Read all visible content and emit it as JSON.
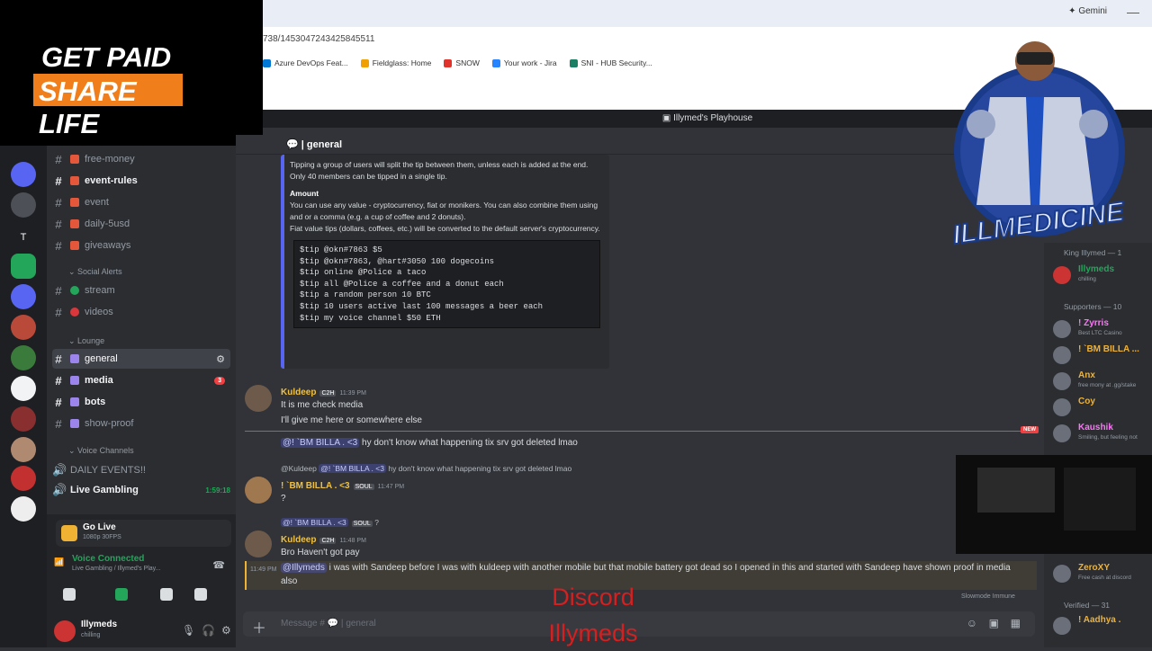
{
  "promo": {
    "line1": "GET PAID",
    "line2": "SHARE LIFE"
  },
  "browser": {
    "gemini_label": "Gemini",
    "url": "738/1453047243425845511",
    "bookmarks": [
      {
        "label": "Azure DevOps Feat...",
        "color": "#0078d4"
      },
      {
        "label": "Fieldglass: Home",
        "color": "#f0a000"
      },
      {
        "label": "SNOW",
        "color": "#e0332b"
      },
      {
        "label": "Your work - Jira",
        "color": "#2684ff"
      },
      {
        "label": "SNI - HUB Security...",
        "color": "#1a7f64"
      }
    ]
  },
  "server": {
    "title": "Illymed's Playhouse"
  },
  "channel_header": {
    "name": "general"
  },
  "sidebar": {
    "channels_top": [
      {
        "label": "free-money",
        "bold": false
      },
      {
        "label": "event-rules",
        "bold": true
      },
      {
        "label": "event",
        "bold": false
      },
      {
        "label": "daily-5usd",
        "bold": false
      },
      {
        "label": "giveaways",
        "bold": false
      }
    ],
    "social_category": "Social Alerts",
    "social_channels": [
      {
        "label": "stream",
        "color": "#23a55a"
      },
      {
        "label": "videos",
        "color": "#da373c"
      }
    ],
    "lounge_category": "Lounge",
    "lounge_channels": [
      {
        "label": "general",
        "active": true
      },
      {
        "label": "media",
        "badge": "3",
        "bold": true
      },
      {
        "label": "bots",
        "bold": true
      },
      {
        "label": "show-proof",
        "bold": false
      }
    ],
    "voice_category": "Voice Channels",
    "voice_channels": [
      {
        "label": "DAILY EVENTS!!"
      },
      {
        "label": "Live Gambling",
        "timer": "1:59:18"
      }
    ]
  },
  "voice_panel": {
    "golive_label": "Go Live",
    "golive_sub": "1080p 30FPS",
    "status": "Voice Connected",
    "location": "Live Gambling / Illymed's Play..."
  },
  "user": {
    "name": "Illymeds",
    "status": "chilling"
  },
  "embed": {
    "para1": "Tipping a group of users will split the tip between them, unless each is added at the end.",
    "para2": "Only 40 members can be tipped in a single tip.",
    "heading": "Amount",
    "para3": "You can use any value - cryptocurrency, fiat or monikers. You can also combine them using and or a comma (e.g. a cup of coffee and 2 donuts).",
    "para4": "Fiat value tips (dollars, coffees, etc.) will be converted to the default server's cryptocurrency.",
    "code": "$tip @okn#7863 $5\n$tip @okn#7863, @hart#3050 100 dogecoins\n$tip online @Police a taco\n$tip all @Police a coffee and a donut each\n$tip a random person 10 BTC\n$tip 10 users active last 100 messages a beer each\n$tip my voice channel $50 ETH"
  },
  "messages": {
    "m1": {
      "author": "Kuldeep",
      "tag": "C2H",
      "time": "11:39 PM",
      "line1": "It is me check media",
      "line2": "I'll give me here or somewhere else"
    },
    "m1_mention": "@! `BM BILLA . <3",
    "m1_mention_text": "hy don't know what happening tix srv got deleted lmao",
    "new_label": "NEW",
    "m2": {
      "reply_author": "@Kuldeep",
      "reply_mention": "@! `BM BILLA . <3",
      "reply_text": "hy don't know what happening tix srv got deleted lmao",
      "author": "! `BM BILLA . <3",
      "tag": "SOUL",
      "time": "11:47 PM",
      "line1": "?"
    },
    "m3": {
      "reply_author": "@! `BM BILLA . <3",
      "reply_tag": "SOUL",
      "reply_text": "?",
      "author": "Kuldeep",
      "tag": "C2H",
      "time": "11:48 PM",
      "line1": "Bro Haven't got pay"
    },
    "m4": {
      "time": "11:49 PM",
      "mention": "@Illymeds",
      "text": "i was with Sandeep before I was with kuldeep with another mobile but that mobile battery got dead so I opened in this and started with Sandeep have shown proof in media also"
    }
  },
  "composer": {
    "placeholder": "Message #",
    "channel": "general"
  },
  "slowmode": "Slowmode Immune",
  "watermark": {
    "line1": "Discord",
    "line2": "Illymeds"
  },
  "members": {
    "group1": "King Illymed — 1",
    "group1_members": [
      {
        "name": "Illymeds",
        "status": "chilling",
        "color": "#23a55a"
      }
    ],
    "group2": "Supporters — 10",
    "group2_members": [
      {
        "name": "! Zyrris",
        "status": "Best LTC Casino",
        "color": "#ff73fa"
      },
      {
        "name": "! `BM BILLA ...",
        "status": "",
        "color": "#f0b232"
      },
      {
        "name": "Anx",
        "status": "free mony at .gg/stake",
        "color": "#f0b232"
      },
      {
        "name": "Coy",
        "status": "",
        "color": "#f0b232"
      },
      {
        "name": "Kaushik",
        "status": "Smiling, but feeling not",
        "color": "#ff73fa"
      }
    ],
    "group3_member": {
      "name": "ZeroXY",
      "status": "Free cash at discord",
      "color": "#f0b232"
    },
    "group3": "Verified — 31",
    "group3_members": [
      {
        "name": "! Aadhya .",
        "status": "",
        "color": "#f0b232"
      }
    ]
  },
  "mascot_text": "ILLMEDICINE"
}
